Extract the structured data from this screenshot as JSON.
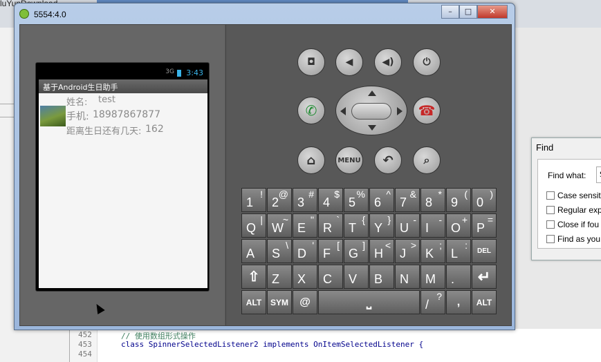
{
  "background": {
    "left_tab_text": "luYunDownload",
    "editor_lines": [
      {
        "num": "452",
        "code": "// 使用数组形式操作"
      },
      {
        "num": "453",
        "code": "class SpinnerSelectedListener2 implements OnItemSelectedListener {"
      },
      {
        "num": "454",
        "code": ""
      }
    ]
  },
  "find_dialog": {
    "title": "Find",
    "find_what_label": "Find what:",
    "find_value": "S",
    "options": [
      "Case sensit",
      "Regular exp",
      "Close if fou",
      "Find as you"
    ]
  },
  "emulator": {
    "title": "5554:4.0",
    "buttons": {
      "minimize": "–",
      "maximize": "□",
      "close": "✕"
    },
    "status_bar": {
      "signal": "3G",
      "time": "3:43"
    },
    "app_title": "基于Android生日助手",
    "record": {
      "name_label": "姓名:",
      "name_value": "test",
      "phone_label": "手机:",
      "phone_value": "18987867877",
      "days_label": "距离生日还有几天:",
      "days_value": "162"
    },
    "controls": {
      "menu_label": "MENU"
    },
    "keyboard": {
      "row1": [
        [
          "1",
          "!"
        ],
        [
          "2",
          "@"
        ],
        [
          "3",
          "#"
        ],
        [
          "4",
          "$"
        ],
        [
          "5",
          "%"
        ],
        [
          "6",
          "^"
        ],
        [
          "7",
          "&"
        ],
        [
          "8",
          "*"
        ],
        [
          "9",
          "("
        ],
        [
          "0",
          ")"
        ]
      ],
      "row2": [
        [
          "Q",
          "|"
        ],
        [
          "W",
          "~"
        ],
        [
          "E",
          "\""
        ],
        [
          "R",
          "`"
        ],
        [
          "T",
          "{"
        ],
        [
          "Y",
          "}"
        ],
        [
          "U",
          "-"
        ],
        [
          "I",
          "-"
        ],
        [
          "O",
          "+"
        ],
        [
          "P",
          "="
        ]
      ],
      "row3": [
        [
          "A",
          ""
        ],
        [
          "S",
          "\\"
        ],
        [
          "D",
          "'"
        ],
        [
          "F",
          "["
        ],
        [
          "G",
          "]"
        ],
        [
          "H",
          "<"
        ],
        [
          "J",
          ">"
        ],
        [
          "K",
          ";"
        ],
        [
          "L",
          ":"
        ]
      ],
      "row3_del": "DEL",
      "row4": [
        [
          "Z",
          ""
        ],
        [
          "X",
          ""
        ],
        [
          "C",
          ""
        ],
        [
          "V",
          ""
        ],
        [
          "B",
          ""
        ],
        [
          "N",
          ""
        ],
        [
          "M",
          ""
        ],
        [
          ".",
          ""
        ]
      ],
      "row5": {
        "alt_left": "ALT",
        "sym": "SYM",
        "at": "@",
        "space": "⎵",
        "slash": "/",
        "slash_alt": "?",
        "comma": ",",
        "alt_right": "ALT"
      }
    }
  }
}
